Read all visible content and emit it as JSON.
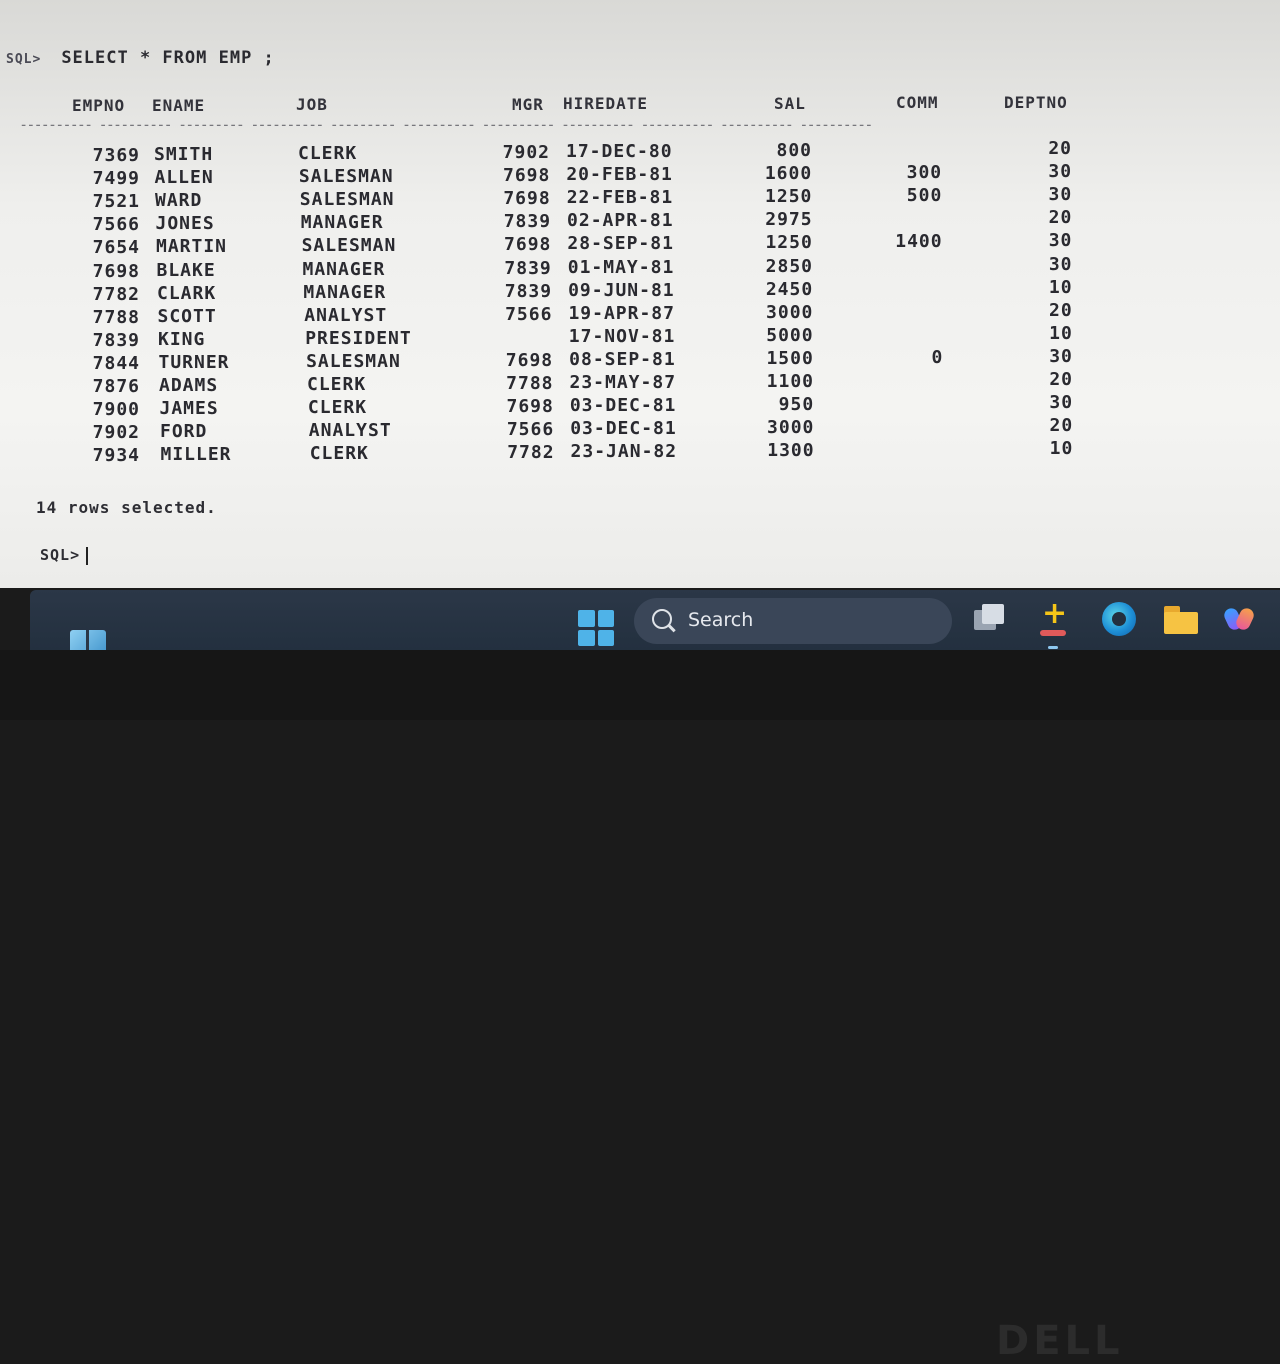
{
  "terminal": {
    "prompt_label": "SQL>",
    "command": "SELECT * FROM EMP ;",
    "columns": [
      "EMPNO",
      "ENAME",
      "JOB",
      "MGR",
      "HIREDATE",
      "SAL",
      "COMM",
      "DEPTNO"
    ],
    "rows": [
      [
        "7369",
        "SMITH",
        "CLERK",
        "7902",
        "17-DEC-80",
        "800",
        "",
        "20"
      ],
      [
        "7499",
        "ALLEN",
        "SALESMAN",
        "7698",
        "20-FEB-81",
        "1600",
        "300",
        "30"
      ],
      [
        "7521",
        "WARD",
        "SALESMAN",
        "7698",
        "22-FEB-81",
        "1250",
        "500",
        "30"
      ],
      [
        "7566",
        "JONES",
        "MANAGER",
        "7839",
        "02-APR-81",
        "2975",
        "",
        "20"
      ],
      [
        "7654",
        "MARTIN",
        "SALESMAN",
        "7698",
        "28-SEP-81",
        "1250",
        "1400",
        "30"
      ],
      [
        "7698",
        "BLAKE",
        "MANAGER",
        "7839",
        "01-MAY-81",
        "2850",
        "",
        "30"
      ],
      [
        "7782",
        "CLARK",
        "MANAGER",
        "7839",
        "09-JUN-81",
        "2450",
        "",
        "10"
      ],
      [
        "7788",
        "SCOTT",
        "ANALYST",
        "7566",
        "19-APR-87",
        "3000",
        "",
        "20"
      ],
      [
        "7839",
        "KING",
        "PRESIDENT",
        "",
        "17-NOV-81",
        "5000",
        "",
        "10"
      ],
      [
        "7844",
        "TURNER",
        "SALESMAN",
        "7698",
        "08-SEP-81",
        "1500",
        "0",
        "30"
      ],
      [
        "7876",
        "ADAMS",
        "CLERK",
        "7788",
        "23-MAY-87",
        "1100",
        "",
        "20"
      ],
      [
        "7900",
        "JAMES",
        "CLERK",
        "7698",
        "03-DEC-81",
        "950",
        "",
        "30"
      ],
      [
        "7902",
        "FORD",
        "ANALYST",
        "7566",
        "03-DEC-81",
        "3000",
        "",
        "20"
      ],
      [
        "7934",
        "MILLER",
        "CLERK",
        "7782",
        "23-JAN-82",
        "1300",
        "",
        "10"
      ]
    ],
    "rows_selected": "14 rows selected.",
    "next_prompt": "SQL>"
  },
  "taskbar": {
    "search_label": "Search",
    "icons": [
      "widgets-icon",
      "start-icon",
      "task-view-icon",
      "sql-developer-icon",
      "edge-icon",
      "file-explorer-icon",
      "copilot-icon"
    ]
  },
  "bezel": {
    "brand": "DELL"
  }
}
